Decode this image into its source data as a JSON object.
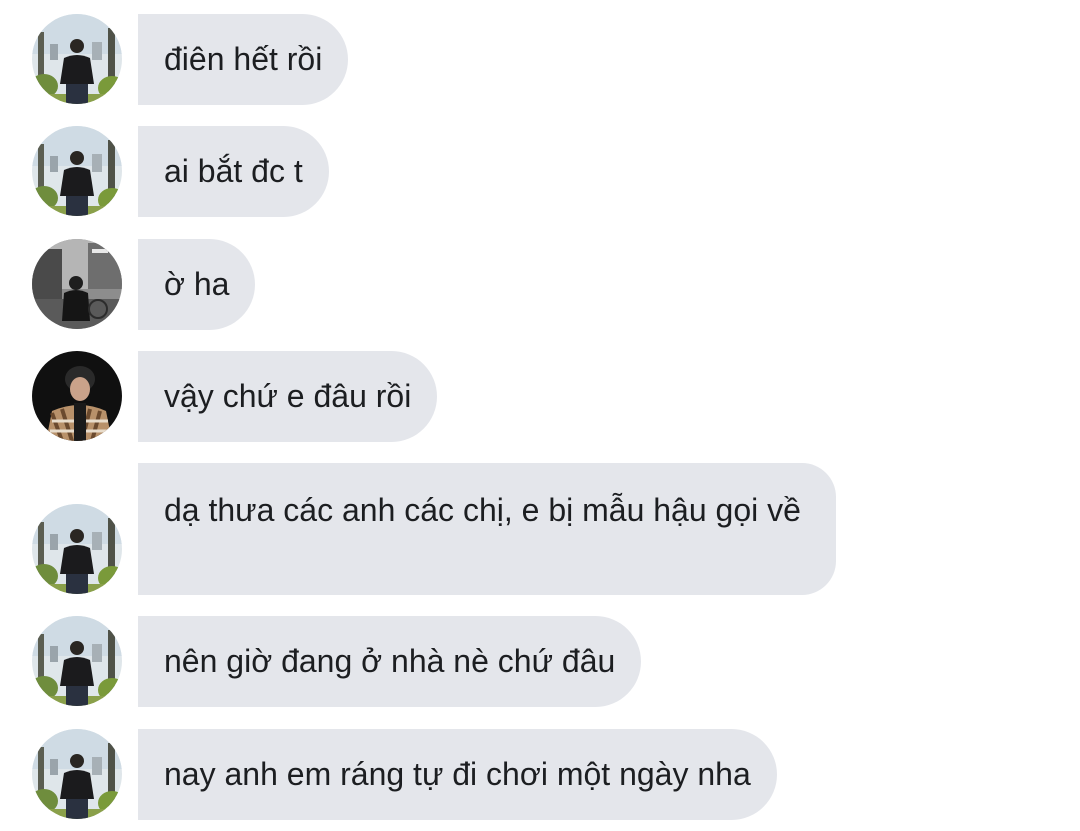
{
  "messages": [
    {
      "text": "điên hết rồi",
      "avatar": "avatar-a"
    },
    {
      "text": "ai bắt đc t",
      "avatar": "avatar-a"
    },
    {
      "text": "ờ ha",
      "avatar": "avatar-b"
    },
    {
      "text": "vậy chứ e đâu rồi",
      "avatar": "avatar-c"
    },
    {
      "text": "dạ thưa các anh các chị, e bị mẫu hậu gọi về",
      "avatar": "avatar-a"
    },
    {
      "text": "nên giờ đang ở nhà nè chứ đâu",
      "avatar": "avatar-a"
    },
    {
      "text": "nay anh em ráng tự đi chơi một ngày nha",
      "avatar": "avatar-a"
    }
  ],
  "colors": {
    "bubble_bg": "#e4e6eb",
    "text": "#1c1e21",
    "page_bg": "#ffffff"
  }
}
